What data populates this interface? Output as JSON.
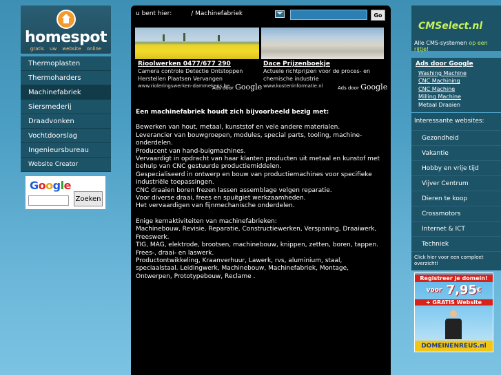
{
  "logo": {
    "title": "homespot",
    "subtitle": "gratis uw website online"
  },
  "nav": [
    {
      "label": "Thermoplasten",
      "active": false
    },
    {
      "label": "Thermoharders",
      "active": false
    },
    {
      "label": "Machinefabriek",
      "active": true
    },
    {
      "label": "Siersmederij",
      "active": false
    },
    {
      "label": "Draadvonken",
      "active": false
    },
    {
      "label": "Vochtdoorslag",
      "active": false
    },
    {
      "label": "Ingenieursbureau",
      "active": false
    },
    {
      "label": "Website Creator",
      "active": false
    }
  ],
  "google_search": {
    "logo_text": "Google",
    "button": "Zoeken"
  },
  "breadcrumb": {
    "prefix": "u bent hier:",
    "current": "/ Machinefabriek"
  },
  "top_search": {
    "button": "Go"
  },
  "ads": [
    {
      "title": "Rioolwerken 0477/677 290",
      "body": "Camera controle Detectie Ontstoppen Herstellen Plaatsen Vervangen",
      "url": "www.rioleringswerken-dammekens.be"
    },
    {
      "title": "Dace Prijzenboekje",
      "body": "Actuele richtprijzen voor de proces- en chemische industrie",
      "url": "www.kosteninformatie.nl"
    }
  ],
  "ads_by": {
    "prefix": "Ads door",
    "brand": "Google"
  },
  "article": {
    "heading": "Een machinefabriek houdt zich bijvoorbeeld bezig met:",
    "para1": "Bewerken van hout, metaal, kunststof en vele andere materialen.\nLeverancier van bouwgroepen, modules, special parts, tooling, machine-onderdelen.\nProducent van hand-buigmachines.\nVervaardigt in opdracht van haar klanten producten uit metaal en kunstof met behulp van CNC gestuurde productiemiddelen.\nGespecialiseerd in ontwerp en bouw van productiemachines voor specifieke industriële toepassingen.\nCNC draaien boren frezen lassen assemblage velgen reparatie.\nVoor diverse draai, frees en spuitgiet werkzaamheden.\nHet vervaardigen van fijnmechanische onderdelen.",
    "para2": "Enige kernaktiviteiten van machinefabrieken:\nMachinebouw, Revisie, Reparatie, Constructiewerken, Verspaning, Draaiwerk, Freeswerk.\nTIG, MAG, elektrode, brootsen, machinebouw, knippen, zetten, boren, tappen. Frees-, draai- en laswerk.\nProductontwikkeling, Kraanverhuur, Lawerk, rvs, aluminium, staal, speciaalstaal. Leidingwerk, Machinebouw, Machinefabriek, Montage, Ontwerpen, Prototypebouw, Reclame ."
  },
  "cms": {
    "logo": "CMSelect.nl",
    "sub_a": "Alle CMS-systemen",
    "sub_b": "op een rijtje!"
  },
  "google_ads_right": {
    "heading": "Ads door Google",
    "links": [
      "Washing Machine",
      "CNC Machining",
      "CNC Machine",
      "Milling Machine"
    ],
    "plain": "Metaal Draaien"
  },
  "interesting": {
    "heading": "Interessante websites:",
    "items": [
      "Gezondheid",
      "Vakantie",
      "Hobby en vrije tijd",
      "Vijver Centrum",
      "Dieren te koop",
      "Crossmotors",
      "Internet & ICT",
      "Techniek"
    ],
    "footer": "Click hier voor een compleet overzicht!"
  },
  "banner": {
    "line1": "Registreer je domein!",
    "price_prefix": "voor",
    "price": "7,95",
    "price_suffix": "€",
    "gratis": "+ GRATIS Website",
    "footer": "DOMEINENREUS.nl"
  }
}
